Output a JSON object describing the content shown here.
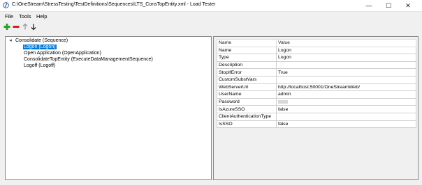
{
  "window": {
    "title": "C:\\OneStream\\StressTesting\\TestDefinitions\\Sequences\\LTS_ConsTopEntity.xml - Load Tester",
    "minimize_glyph": "—",
    "maximize_glyph": "☐",
    "close_glyph": "✕"
  },
  "menu": {
    "items": [
      "File",
      "Tools",
      "Help"
    ]
  },
  "toolbar": {
    "add_icon_color": "#2e9e2e",
    "remove_icon_color": "#d21f1f",
    "up_glyph": "↑",
    "down_glyph": "↓"
  },
  "tree": {
    "root_label": "Consolidate (Sequence)",
    "children": [
      {
        "label": "Logon (Logon)",
        "selected": true
      },
      {
        "label": "Open Application (OpenApplication)",
        "selected": false
      },
      {
        "label": "ConsolidateTopEntity (ExecuteDataManagementSequence)",
        "selected": false
      },
      {
        "label": "Logoff (Logoff)",
        "selected": false
      }
    ]
  },
  "grid": {
    "header": {
      "name": "Name",
      "value": "Value"
    },
    "rows": [
      {
        "name": "Name",
        "value": "Logon"
      },
      {
        "name": "Type",
        "value": "Logon"
      },
      {
        "name": "Description",
        "value": ""
      },
      {
        "name": "StopIfError",
        "value": "True"
      },
      {
        "name": "CustomSubstVars",
        "value": ""
      },
      {
        "name": "WebServerUrl",
        "value": "http://localhost:50001/OneStreamWeb/"
      },
      {
        "name": "UserName",
        "value": "admin"
      },
      {
        "name": "Password",
        "value": "",
        "masked": true
      },
      {
        "name": "IsAzureSSO",
        "value": "false"
      },
      {
        "name": "ClientAuthenticationType",
        "value": ""
      },
      {
        "name": "IsSSO",
        "value": "false"
      }
    ]
  },
  "colors": {
    "selection": "#0078d7",
    "background": "#f0f0f0"
  }
}
